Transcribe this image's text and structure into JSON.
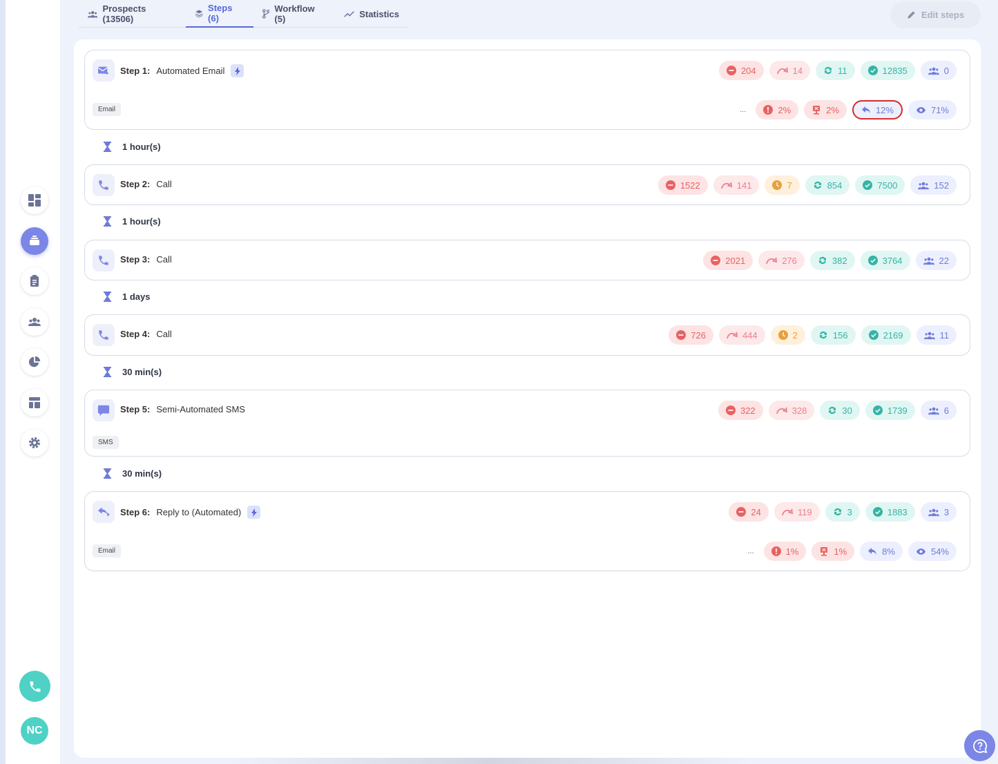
{
  "tabs": [
    {
      "label": "Prospects (13506)",
      "icon": "users-icon"
    },
    {
      "label": "Steps (6)",
      "icon": "layers-icon"
    },
    {
      "label": "Workflow (5)",
      "icon": "workflow-icon"
    },
    {
      "label": "Statistics",
      "icon": "chart-line-icon"
    }
  ],
  "header": {
    "edit_label": "Edit steps"
  },
  "sidebar": {
    "avatar_initials": "NC"
  },
  "steps": [
    {
      "label": "Step 1:",
      "name": "Automated Email",
      "tag": "Email",
      "stats": [
        "204",
        "14",
        "11",
        "12835",
        "0"
      ],
      "stats2": {
        "dots": "...",
        "values": [
          "2%",
          "2%",
          "12%",
          "71%"
        ]
      }
    },
    {
      "label": "Step 2:",
      "name": "Call",
      "stats": [
        "1522",
        "141",
        "7",
        "854",
        "7500",
        "152"
      ]
    },
    {
      "label": "Step 3:",
      "name": "Call",
      "stats": [
        "2021",
        "276",
        "382",
        "3764",
        "22"
      ]
    },
    {
      "label": "Step 4:",
      "name": "Call",
      "stats": [
        "726",
        "444",
        "2",
        "156",
        "2169",
        "11"
      ]
    },
    {
      "label": "Step 5:",
      "name": "Semi-Automated SMS",
      "tag": "SMS",
      "stats": [
        "322",
        "328",
        "30",
        "1739",
        "6"
      ]
    },
    {
      "label": "Step 6:",
      "name": "Reply to (Automated)",
      "tag": "Email",
      "stats": [
        "24",
        "119",
        "3",
        "1883",
        "3"
      ],
      "stats2": {
        "dots": "...",
        "values": [
          "1%",
          "1%",
          "8%",
          "54%"
        ]
      }
    }
  ],
  "delays": [
    "1 hour(s)",
    "1 hour(s)",
    "1 days",
    "30 min(s)",
    "30 min(s)"
  ],
  "colors": {
    "accent": "#5a67d8",
    "teal": "#4fd1c5",
    "red": "#e76262",
    "selected_outline": "#d62b2b"
  }
}
